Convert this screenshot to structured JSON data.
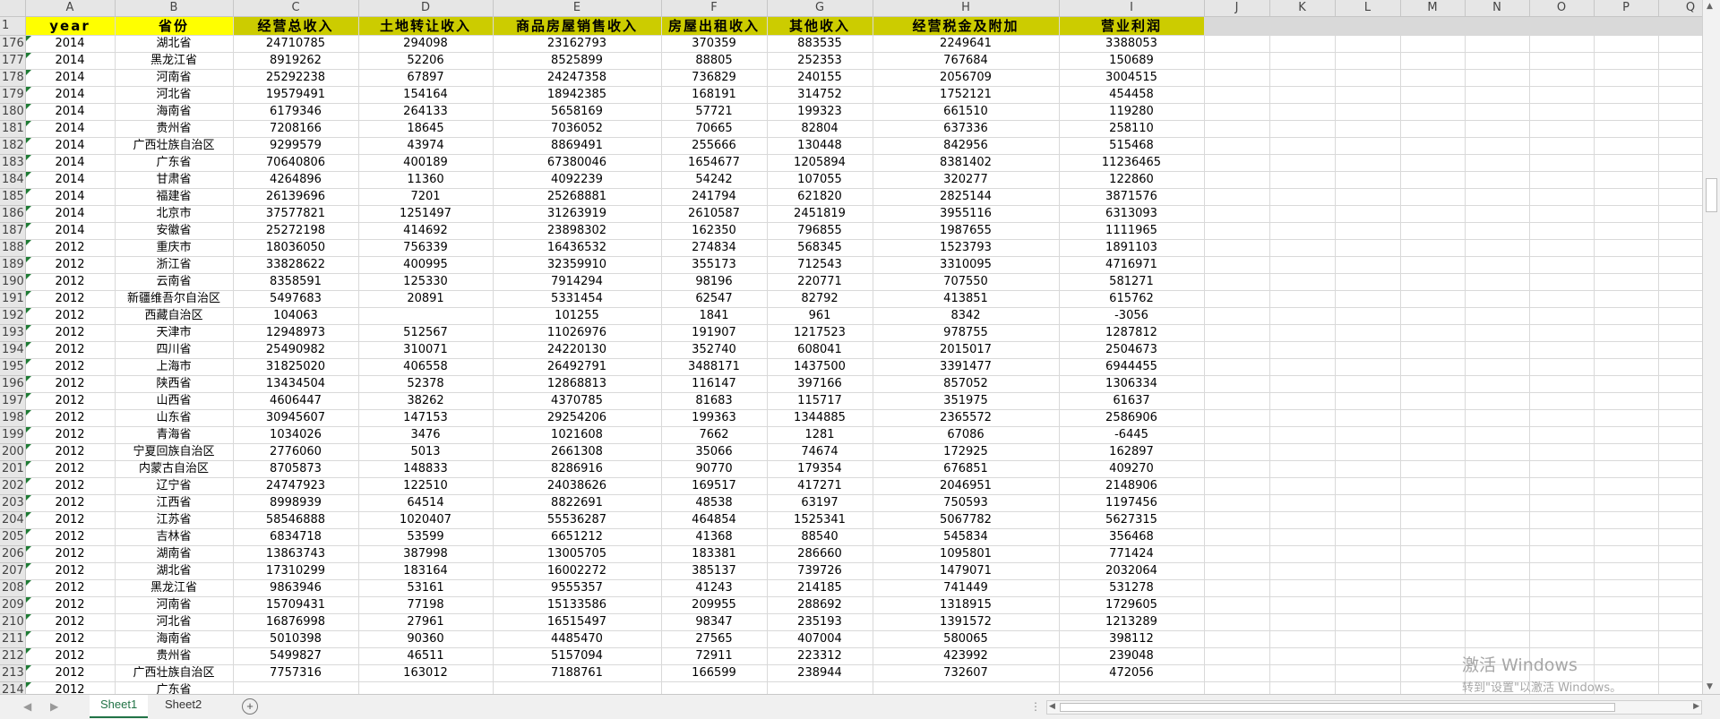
{
  "columns": [
    "A",
    "B",
    "C",
    "D",
    "E",
    "F",
    "G",
    "H",
    "I",
    "J",
    "K",
    "L",
    "M",
    "N",
    "O",
    "P",
    "Q"
  ],
  "header_row": {
    "number": "1",
    "cells": [
      "year",
      "省份",
      "经营总收入",
      "土地转让收入",
      "商品房屋销售收入",
      "房屋出租收入",
      "其他收入",
      "经营税金及附加",
      "营业利润"
    ]
  },
  "rows": [
    {
      "n": "176",
      "c": [
        "2014",
        "湖北省",
        "24710785",
        "294098",
        "23162793",
        "370359",
        "883535",
        "2249641",
        "3388053"
      ]
    },
    {
      "n": "177",
      "c": [
        "2014",
        "黑龙江省",
        "8919262",
        "52206",
        "8525899",
        "88805",
        "252353",
        "767684",
        "150689"
      ]
    },
    {
      "n": "178",
      "c": [
        "2014",
        "河南省",
        "25292238",
        "67897",
        "24247358",
        "736829",
        "240155",
        "2056709",
        "3004515"
      ]
    },
    {
      "n": "179",
      "c": [
        "2014",
        "河北省",
        "19579491",
        "154164",
        "18942385",
        "168191",
        "314752",
        "1752121",
        "454458"
      ]
    },
    {
      "n": "180",
      "c": [
        "2014",
        "海南省",
        "6179346",
        "264133",
        "5658169",
        "57721",
        "199323",
        "661510",
        "119280"
      ]
    },
    {
      "n": "181",
      "c": [
        "2014",
        "贵州省",
        "7208166",
        "18645",
        "7036052",
        "70665",
        "82804",
        "637336",
        "258110"
      ]
    },
    {
      "n": "182",
      "c": [
        "2014",
        "广西壮族自治区",
        "9299579",
        "43974",
        "8869491",
        "255666",
        "130448",
        "842956",
        "515468"
      ]
    },
    {
      "n": "183",
      "c": [
        "2014",
        "广东省",
        "70640806",
        "400189",
        "67380046",
        "1654677",
        "1205894",
        "8381402",
        "11236465"
      ]
    },
    {
      "n": "184",
      "c": [
        "2014",
        "甘肃省",
        "4264896",
        "11360",
        "4092239",
        "54242",
        "107055",
        "320277",
        "122860"
      ]
    },
    {
      "n": "185",
      "c": [
        "2014",
        "福建省",
        "26139696",
        "7201",
        "25268881",
        "241794",
        "621820",
        "2825144",
        "3871576"
      ]
    },
    {
      "n": "186",
      "c": [
        "2014",
        "北京市",
        "37577821",
        "1251497",
        "31263919",
        "2610587",
        "2451819",
        "3955116",
        "6313093"
      ]
    },
    {
      "n": "187",
      "c": [
        "2014",
        "安徽省",
        "25272198",
        "414692",
        "23898302",
        "162350",
        "796855",
        "1987655",
        "1111965"
      ]
    },
    {
      "n": "188",
      "c": [
        "2012",
        "重庆市",
        "18036050",
        "756339",
        "16436532",
        "274834",
        "568345",
        "1523793",
        "1891103"
      ]
    },
    {
      "n": "189",
      "c": [
        "2012",
        "浙江省",
        "33828622",
        "400995",
        "32359910",
        "355173",
        "712543",
        "3310095",
        "4716971"
      ]
    },
    {
      "n": "190",
      "c": [
        "2012",
        "云南省",
        "8358591",
        "125330",
        "7914294",
        "98196",
        "220771",
        "707550",
        "581271"
      ]
    },
    {
      "n": "191",
      "c": [
        "2012",
        "新疆维吾尔自治区",
        "5497683",
        "20891",
        "5331454",
        "62547",
        "82792",
        "413851",
        "615762"
      ]
    },
    {
      "n": "192",
      "c": [
        "2012",
        "西藏自治区",
        "104063",
        "",
        "101255",
        "1841",
        "961",
        "8342",
        "-3056"
      ]
    },
    {
      "n": "193",
      "c": [
        "2012",
        "天津市",
        "12948973",
        "512567",
        "11026976",
        "191907",
        "1217523",
        "978755",
        "1287812"
      ]
    },
    {
      "n": "194",
      "c": [
        "2012",
        "四川省",
        "25490982",
        "310071",
        "24220130",
        "352740",
        "608041",
        "2015017",
        "2504673"
      ]
    },
    {
      "n": "195",
      "c": [
        "2012",
        "上海市",
        "31825020",
        "406558",
        "26492791",
        "3488171",
        "1437500",
        "3391477",
        "6944455"
      ]
    },
    {
      "n": "196",
      "c": [
        "2012",
        "陕西省",
        "13434504",
        "52378",
        "12868813",
        "116147",
        "397166",
        "857052",
        "1306334"
      ]
    },
    {
      "n": "197",
      "c": [
        "2012",
        "山西省",
        "4606447",
        "38262",
        "4370785",
        "81683",
        "115717",
        "351975",
        "61637"
      ]
    },
    {
      "n": "198",
      "c": [
        "2012",
        "山东省",
        "30945607",
        "147153",
        "29254206",
        "199363",
        "1344885",
        "2365572",
        "2586906"
      ]
    },
    {
      "n": "199",
      "c": [
        "2012",
        "青海省",
        "1034026",
        "3476",
        "1021608",
        "7662",
        "1281",
        "67086",
        "-6445"
      ]
    },
    {
      "n": "200",
      "c": [
        "2012",
        "宁夏回族自治区",
        "2776060",
        "5013",
        "2661308",
        "35066",
        "74674",
        "172925",
        "162897"
      ]
    },
    {
      "n": "201",
      "c": [
        "2012",
        "内蒙古自治区",
        "8705873",
        "148833",
        "8286916",
        "90770",
        "179354",
        "676851",
        "409270"
      ]
    },
    {
      "n": "202",
      "c": [
        "2012",
        "辽宁省",
        "24747923",
        "122510",
        "24038626",
        "169517",
        "417271",
        "2046951",
        "2148906"
      ]
    },
    {
      "n": "203",
      "c": [
        "2012",
        "江西省",
        "8998939",
        "64514",
        "8822691",
        "48538",
        "63197",
        "750593",
        "1197456"
      ]
    },
    {
      "n": "204",
      "c": [
        "2012",
        "江苏省",
        "58546888",
        "1020407",
        "55536287",
        "464854",
        "1525341",
        "5067782",
        "5627315"
      ]
    },
    {
      "n": "205",
      "c": [
        "2012",
        "吉林省",
        "6834718",
        "53599",
        "6651212",
        "41368",
        "88540",
        "545834",
        "356468"
      ]
    },
    {
      "n": "206",
      "c": [
        "2012",
        "湖南省",
        "13863743",
        "387998",
        "13005705",
        "183381",
        "286660",
        "1095801",
        "771424"
      ]
    },
    {
      "n": "207",
      "c": [
        "2012",
        "湖北省",
        "17310299",
        "183164",
        "16002272",
        "385137",
        "739726",
        "1479071",
        "2032064"
      ]
    },
    {
      "n": "208",
      "c": [
        "2012",
        "黑龙江省",
        "9863946",
        "53161",
        "9555357",
        "41243",
        "214185",
        "741449",
        "531278"
      ]
    },
    {
      "n": "209",
      "c": [
        "2012",
        "河南省",
        "15709431",
        "77198",
        "15133586",
        "209955",
        "288692",
        "1318915",
        "1729605"
      ]
    },
    {
      "n": "210",
      "c": [
        "2012",
        "河北省",
        "16876998",
        "27961",
        "16515497",
        "98347",
        "235193",
        "1391572",
        "1213289"
      ]
    },
    {
      "n": "211",
      "c": [
        "2012",
        "海南省",
        "5010398",
        "90360",
        "4485470",
        "27565",
        "407004",
        "580065",
        "398112"
      ]
    },
    {
      "n": "212",
      "c": [
        "2012",
        "贵州省",
        "5499827",
        "46511",
        "5157094",
        "72911",
        "223312",
        "423992",
        "239048"
      ]
    },
    {
      "n": "213",
      "c": [
        "2012",
        "广西壮族自治区",
        "7757316",
        "163012",
        "7188761",
        "166599",
        "238944",
        "732607",
        "472056"
      ]
    },
    {
      "n": "214",
      "c": [
        "2012",
        "广东省",
        "",
        "",
        "",
        "",
        "",
        "",
        ""
      ]
    }
  ],
  "sheet_tabs": [
    "Sheet1",
    "Sheet2"
  ],
  "active_tab": "Sheet1",
  "add_sheet_icon": "+",
  "watermark": {
    "line1": "激活 Windows",
    "line2": "转到\"设置\"以激活 Windows。"
  },
  "colors": {
    "header_fill_yellow": "#ffff00",
    "header_fill_olive": "#cccc00",
    "accent": "#217346",
    "error_triangle": "#1e7b34"
  }
}
